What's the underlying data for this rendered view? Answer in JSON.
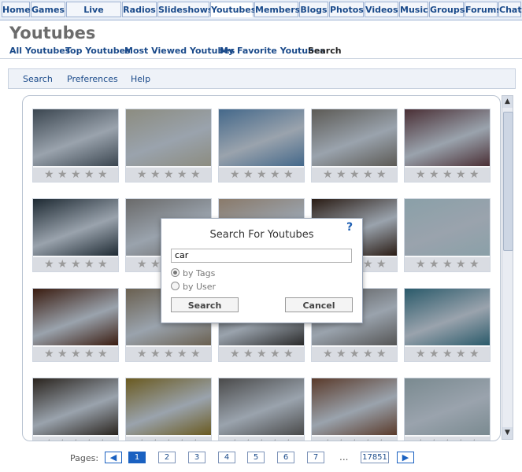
{
  "top_tabs": [
    "Home",
    "Games",
    "Live Camera",
    "Radios",
    "Slideshows",
    "Youtubes",
    "Members",
    "Blogs",
    "Photos",
    "Videos",
    "Music",
    "Groups",
    "Forums",
    "Chat"
  ],
  "active_tab": "Youtubes",
  "page": {
    "title": "Youtubes",
    "subnav": [
      "All Youtubes",
      "Top Youtubes",
      "Most Viewed Youtubes",
      "My Favorite Youtubes",
      "Search"
    ]
  },
  "toolbar": [
    "Search",
    "Preferences",
    "Help"
  ],
  "gallery": {
    "stars_per_thumb": 5,
    "star_glyph": "★"
  },
  "dialog": {
    "title": "Search For Youtubes",
    "help_glyph": "?",
    "query": "car",
    "options": [
      {
        "label": "by Tags",
        "selected": true
      },
      {
        "label": "by User",
        "selected": false
      }
    ],
    "search_label": "Search",
    "cancel_label": "Cancel"
  },
  "pager": {
    "label": "Pages:",
    "prev_glyph": "◀",
    "next_glyph": "▶",
    "pages": [
      "1",
      "2",
      "3",
      "4",
      "5",
      "6",
      "7"
    ],
    "current_page": "1",
    "ellipsis": "...",
    "last_page": "17851"
  },
  "colors": {
    "link_blue": "#1a4a8a",
    "accent_blue": "#1a61c1",
    "rating_bar": "#d9dce2"
  },
  "scrollbar_glyphs": {
    "up": "▲",
    "down": "▼"
  }
}
